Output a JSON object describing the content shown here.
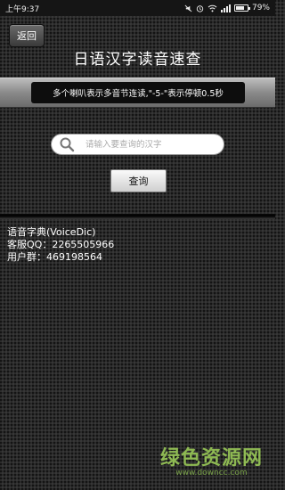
{
  "status": {
    "time": "上午9:37",
    "battery": "79%",
    "battery_level": 0.79,
    "icons": [
      "silent-icon",
      "alarm-icon",
      "wifi-icon",
      "signal-icon",
      "battery-icon"
    ]
  },
  "header": {
    "back_label": "返回",
    "title": "日语汉字读音速查"
  },
  "banner": {
    "text": "多个喇叭表示多音节连读,\"-5-\"表示停顿0.5秒"
  },
  "search": {
    "placeholder": "请输入要查询的汉字",
    "value": "",
    "button_label": "查询"
  },
  "info": {
    "line1": "语音字典(VoiceDic)",
    "line2": "客服QQ：2265505966",
    "line3": "用户群：469198564"
  },
  "watermark": {
    "title": "绿色资源网",
    "url": "www.downcc.com"
  },
  "colors": {
    "background": "#2b2b2b",
    "watermark": "#a0d25a"
  }
}
